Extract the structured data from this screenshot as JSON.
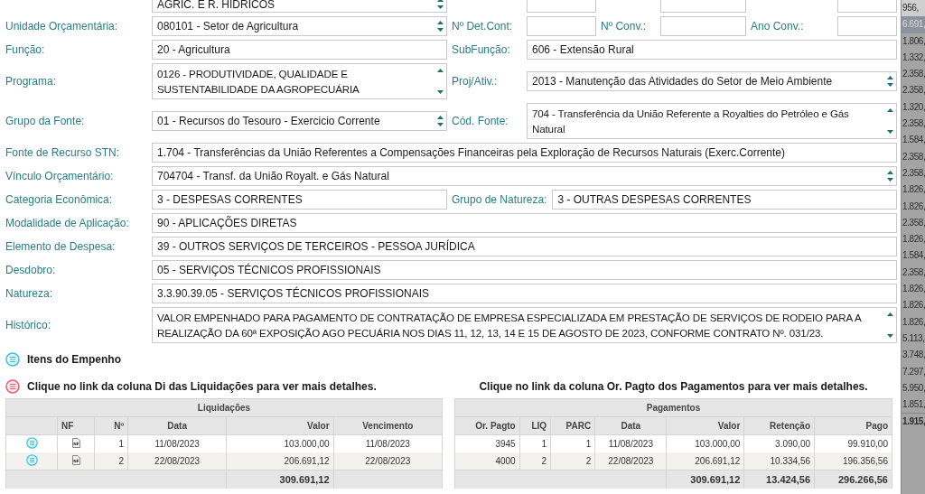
{
  "form": {
    "rows": [
      {
        "fields": [
          {
            "kind": "spin",
            "value": "AGRIC. E R. HIDRICOS"
          },
          {
            "kind": "text"
          },
          {
            "kind": "text"
          },
          {
            "kind": "text"
          }
        ]
      },
      {
        "fields": [
          {
            "label": "Unidade Orçamentária:",
            "kind": "spin",
            "value": "080101 - Setor de Agricultura"
          },
          {
            "label": "Nº Det.Cont:",
            "kind": "text"
          },
          {
            "label": "Nº Conv.:",
            "kind": "text"
          },
          {
            "label": "Ano Conv.:",
            "kind": "text"
          }
        ]
      },
      {
        "fields": [
          {
            "label": "Função:",
            "kind": "text",
            "value": "20 - Agricultura"
          },
          {
            "label": "SubFunção:",
            "kind": "text",
            "value": "606 - Extensão Rural"
          }
        ]
      },
      {
        "fields": [
          {
            "label": "Programa:",
            "kind": "memo",
            "value": "0126 - PRODUTIVIDADE, QUALIDADE E SUSTENTABILIDADE DA AGROPECUÁRIA"
          },
          {
            "label": "Proj/Ativ.:",
            "kind": "spin",
            "value": "2013 - Manutenção das Atividades do Setor de Meio Ambiente"
          }
        ]
      },
      {
        "fields": [
          {
            "label": "Grupo da Fonte:",
            "kind": "spin",
            "value": "01 - Recursos do Tesouro - Exercicio Corrente"
          },
          {
            "label": "Cód. Fonte:",
            "kind": "memo",
            "value": "704 - Transferência da União Referente a Royalties do Petróleo e Gás Natural"
          }
        ]
      },
      {
        "fields": [
          {
            "label": "Fonte de Recurso STN:",
            "kind": "text",
            "value": "1.704 - Transferências da União Referentes a Compensações Financeiras pela Exploração de Recursos Naturais (Exerc.Corrente)"
          }
        ]
      },
      {
        "fields": [
          {
            "label": "Vínculo Orçamentário:",
            "kind": "spin",
            "value": "704704 - Transf. da União Royalt. e Gás Natural"
          }
        ]
      },
      {
        "fields": [
          {
            "label": "Categoria Econômica:",
            "kind": "text",
            "value": "3 - DESPESAS CORRENTES"
          },
          {
            "label": "Grupo de Natureza:",
            "kind": "text",
            "value": "3 - OUTRAS DESPESAS CORRENTES"
          }
        ]
      },
      {
        "fields": [
          {
            "label": "Modalidade de Aplicação:",
            "kind": "text",
            "value": "90 - APLICAÇÕES DIRETAS"
          }
        ]
      },
      {
        "fields": [
          {
            "label": "Elemento de Despesa:",
            "kind": "text",
            "value": "39 - OUTROS SERVIÇOS DE TERCEIROS - PESSOA JURÍDICA"
          }
        ]
      },
      {
        "fields": [
          {
            "label": "Desdobro:",
            "kind": "text",
            "value": "05 - SERVIÇOS TÉCNICOS PROFISSIONAIS"
          }
        ]
      },
      {
        "fields": [
          {
            "label": "Natureza:",
            "kind": "text",
            "value": "3.3.90.39.05 - SERVIÇOS TÉCNICOS PROFISSIONAIS"
          }
        ]
      },
      {
        "fields": [
          {
            "label": "Histórico:",
            "kind": "memo",
            "value": "VALOR EMPENHADO PARA PAGAMENTO DE CONTRATAÇÃO DE EMPRESA ESPECIALIZADA EM PRESTAÇÃO DE SERVIÇOS DE RODEIO PARA A REALIZAÇÃO DA 60ª EXPOSIÇÃO AGO PECUÁRIA NOS DIAS 11, 12, 13, 14 E 15 DE AGOSTO DE 2023, CONFORME CONTRATO Nº. 031/23."
          }
        ]
      }
    ]
  },
  "itens_link": "Itens do Empenho",
  "liquidacoes": {
    "hint": "Clique no link da coluna Di das Liquidações para ver mais detalhes.",
    "title": "Liquidações",
    "columns": [
      "NF",
      "Nº",
      "Data",
      "Valor",
      "Vencimento"
    ],
    "rows": [
      {
        "n": "1",
        "data": "11/08/2023",
        "valor": "103.000,00",
        "vencimento": "11/08/2023"
      },
      {
        "n": "2",
        "data": "22/08/2023",
        "valor": "206.691,12",
        "vencimento": "22/08/2023"
      }
    ],
    "total": "309.691,12"
  },
  "pagamentos": {
    "hint": "Clique no link da coluna Or. Pagto dos Pagamentos para ver mais detalhes.",
    "title": "Pagamentos",
    "columns": [
      "Or. Pagto",
      "LIQ",
      "PARC",
      "Data",
      "Valor",
      "Retenção",
      "Pago"
    ],
    "rows": [
      [
        "3945",
        "1",
        "1",
        "11/08/2023",
        "103.000,00",
        "3.090,00",
        "99.910,00"
      ],
      [
        "4000",
        "2",
        "2",
        "22/08/2023",
        "206.691,12",
        "10.334,56",
        "196.356,56"
      ]
    ],
    "totals": [
      "309.691,12",
      "13.424,56",
      "296.266,56"
    ]
  },
  "background_list": {
    "items": [
      {
        "value": "956,",
        "selected": false,
        "kind": "row"
      },
      {
        "value": "6.691,",
        "selected": true,
        "kind": "row"
      },
      {
        "value": "1.806,",
        "selected": false,
        "kind": "row"
      },
      {
        "value": "1.332,",
        "selected": false,
        "kind": "row"
      },
      {
        "value": "2.358,",
        "selected": false,
        "kind": "row"
      },
      {
        "value": "2.358,",
        "selected": false,
        "kind": "row"
      },
      {
        "value": "1.320,",
        "selected": false,
        "kind": "row"
      },
      {
        "value": "2.358,",
        "selected": false,
        "kind": "row"
      },
      {
        "value": "1.584,",
        "selected": false,
        "kind": "row"
      },
      {
        "value": "2.358,",
        "selected": false,
        "kind": "row"
      },
      {
        "value": "2.358,",
        "selected": false,
        "kind": "row"
      },
      {
        "value": "1.826,",
        "selected": false,
        "kind": "row"
      },
      {
        "value": "1.826,",
        "selected": false,
        "kind": "row"
      },
      {
        "value": "2.358,",
        "selected": false,
        "kind": "row"
      },
      {
        "value": "1.826,",
        "selected": false,
        "kind": "row"
      },
      {
        "value": "1.584,",
        "selected": false,
        "kind": "row"
      },
      {
        "value": "2.358,",
        "selected": false,
        "kind": "row"
      },
      {
        "value": "1.826,",
        "selected": false,
        "kind": "row"
      },
      {
        "value": "1.826,",
        "selected": false,
        "kind": "row"
      },
      {
        "value": "1.826,",
        "selected": false,
        "kind": "row"
      },
      {
        "value": "5.113,",
        "selected": false,
        "kind": "row"
      },
      {
        "value": "3.748,",
        "selected": false,
        "kind": "row"
      },
      {
        "value": "7.297,",
        "selected": false,
        "kind": "row"
      },
      {
        "value": "5.950,",
        "selected": false,
        "kind": "row"
      },
      {
        "value": "1.851,",
        "selected": false,
        "kind": "row"
      },
      {
        "value": "1.915,",
        "selected": false,
        "kind": "total"
      }
    ]
  }
}
